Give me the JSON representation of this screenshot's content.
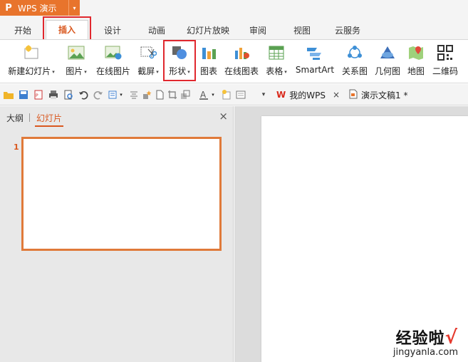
{
  "app": {
    "name": "WPS 演示",
    "logo_glyph": "P",
    "dropdown": "▾"
  },
  "tabs": [
    {
      "label": "开始"
    },
    {
      "label": "插入",
      "active": true
    },
    {
      "label": "设计"
    },
    {
      "label": "动画"
    },
    {
      "label": "幻灯片放映"
    },
    {
      "label": "审阅"
    },
    {
      "label": "视图"
    },
    {
      "label": "云服务"
    }
  ],
  "ribbon": {
    "new_slide": "新建幻灯片",
    "picture": "图片",
    "online_picture": "在线图片",
    "screenshot": "截屏",
    "shape": "形状",
    "chart": "图表",
    "online_chart": "在线图表",
    "table": "表格",
    "smartart": "SmartArt",
    "relation": "关系图",
    "geometry": "几何图",
    "map": "地图",
    "qrcode": "二维码",
    "arrow": "▾"
  },
  "quickbar": {
    "my_wps": "我的WPS",
    "doc_name": "演示文稿1 *",
    "close": "×"
  },
  "left_panel": {
    "tab_outline": "大纲",
    "tab_slides": "幻灯片",
    "close": "×",
    "slide_number": "1"
  },
  "watermark": {
    "brand": "经验啦",
    "check": "√",
    "url": "jingyanla.com"
  },
  "colors": {
    "accent": "#e8742c",
    "active_text": "#d9581f",
    "highlight": "#e0282e"
  }
}
